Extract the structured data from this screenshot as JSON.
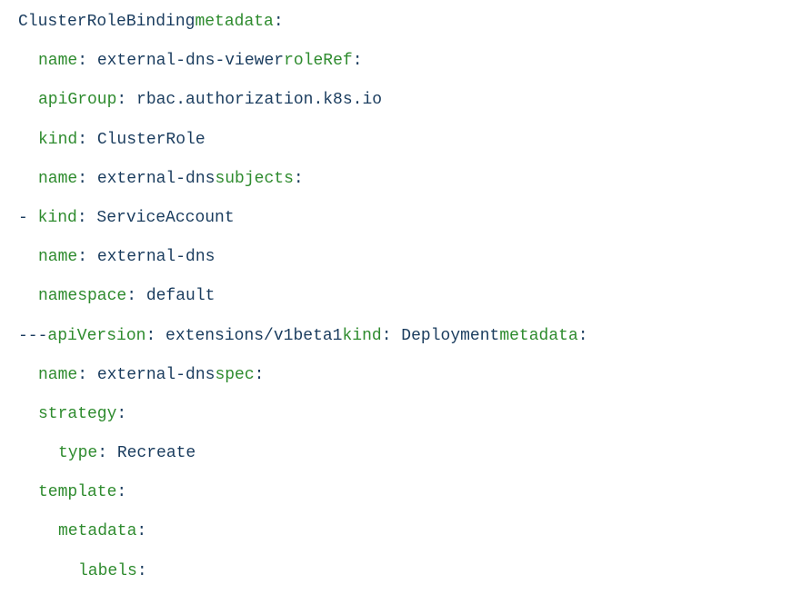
{
  "lines": [
    {
      "segments": [
        {
          "text": "ClusterRoleBinding",
          "cls": "value"
        },
        {
          "text": "metadata",
          "cls": "key"
        },
        {
          "text": ":",
          "cls": "value"
        }
      ],
      "indent": 0
    },
    {
      "segments": [
        {
          "text": "name",
          "cls": "key"
        },
        {
          "text": ": external-dns-viewer",
          "cls": "value"
        },
        {
          "text": "roleRef",
          "cls": "key"
        },
        {
          "text": ":",
          "cls": "value"
        }
      ],
      "indent": 1
    },
    {
      "segments": [
        {
          "text": "apiGroup",
          "cls": "key"
        },
        {
          "text": ": rbac.authorization.k8s.io",
          "cls": "value"
        }
      ],
      "indent": 1
    },
    {
      "segments": [
        {
          "text": "kind",
          "cls": "key"
        },
        {
          "text": ": ClusterRole",
          "cls": "value"
        }
      ],
      "indent": 1
    },
    {
      "segments": [
        {
          "text": "name",
          "cls": "key"
        },
        {
          "text": ": external-dns",
          "cls": "value"
        },
        {
          "text": "subjects",
          "cls": "key"
        },
        {
          "text": ":",
          "cls": "value"
        }
      ],
      "indent": 1
    },
    {
      "segments": [
        {
          "text": "- ",
          "cls": "dash"
        },
        {
          "text": "kind",
          "cls": "key"
        },
        {
          "text": ": ServiceAccount",
          "cls": "value"
        }
      ],
      "indent": 0
    },
    {
      "segments": [
        {
          "text": "name",
          "cls": "key"
        },
        {
          "text": ": external-dns",
          "cls": "value"
        }
      ],
      "indent": 1
    },
    {
      "segments": [
        {
          "text": "namespace",
          "cls": "key"
        },
        {
          "text": ": default",
          "cls": "value"
        }
      ],
      "indent": 1
    },
    {
      "segments": [
        {
          "text": "---",
          "cls": "value"
        },
        {
          "text": "apiVersion",
          "cls": "key"
        },
        {
          "text": ": extensions/v1beta1",
          "cls": "value"
        },
        {
          "text": "kind",
          "cls": "key"
        },
        {
          "text": ": Deployment",
          "cls": "value"
        },
        {
          "text": "metadata",
          "cls": "key"
        },
        {
          "text": ":",
          "cls": "value"
        }
      ],
      "indent": 0
    },
    {
      "segments": [
        {
          "text": "name",
          "cls": "key"
        },
        {
          "text": ": external-dns",
          "cls": "value"
        },
        {
          "text": "spec",
          "cls": "key"
        },
        {
          "text": ":",
          "cls": "value"
        }
      ],
      "indent": 1
    },
    {
      "segments": [
        {
          "text": "strategy",
          "cls": "key"
        },
        {
          "text": ":",
          "cls": "value"
        }
      ],
      "indent": 1
    },
    {
      "segments": [
        {
          "text": "type",
          "cls": "key"
        },
        {
          "text": ": Recreate",
          "cls": "value"
        }
      ],
      "indent": 2
    },
    {
      "segments": [
        {
          "text": "template",
          "cls": "key"
        },
        {
          "text": ":",
          "cls": "value"
        }
      ],
      "indent": 1
    },
    {
      "segments": [
        {
          "text": "metadata",
          "cls": "key"
        },
        {
          "text": ":",
          "cls": "value"
        }
      ],
      "indent": 2
    },
    {
      "segments": [
        {
          "text": "labels",
          "cls": "key"
        },
        {
          "text": ":",
          "cls": "value"
        }
      ],
      "indent": 3
    }
  ]
}
